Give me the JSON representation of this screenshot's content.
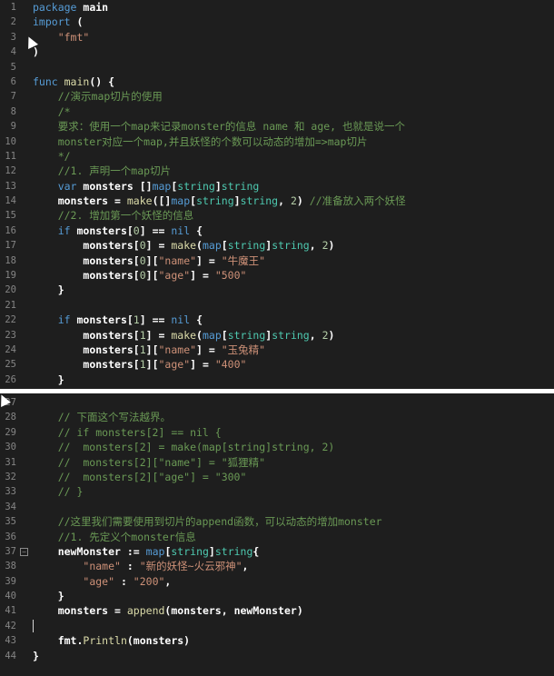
{
  "top_lines": [
    {
      "n": "1",
      "tokens": [
        {
          "t": "package ",
          "c": "kw"
        },
        {
          "t": "main",
          "c": "wt"
        }
      ]
    },
    {
      "n": "2",
      "tokens": [
        {
          "t": "import ",
          "c": "kw"
        },
        {
          "t": "(",
          "c": "wt"
        }
      ]
    },
    {
      "n": "3",
      "tokens": [
        {
          "t": "    ",
          "c": ""
        },
        {
          "t": "\"fmt\"",
          "c": "str"
        }
      ]
    },
    {
      "n": "4",
      "tokens": [
        {
          "t": ")",
          "c": "wt"
        }
      ]
    },
    {
      "n": "5",
      "tokens": []
    },
    {
      "n": "6",
      "tokens": [
        {
          "t": "func ",
          "c": "kw"
        },
        {
          "t": "main",
          "c": "fn"
        },
        {
          "t": "() {",
          "c": "wt"
        }
      ]
    },
    {
      "n": "7",
      "tokens": [
        {
          "t": "    //演示map切片的使用",
          "c": "cm"
        }
      ]
    },
    {
      "n": "8",
      "tokens": [
        {
          "t": "    /*",
          "c": "cm"
        }
      ]
    },
    {
      "n": "9",
      "tokens": [
        {
          "t": "    要求：使用一个map来记录monster的信息 name 和 age, 也就是说一个",
          "c": "cm"
        }
      ]
    },
    {
      "n": "10",
      "tokens": [
        {
          "t": "    monster对应一个map,并且妖怪的个数可以动态的增加=>map切片",
          "c": "cm"
        }
      ]
    },
    {
      "n": "11",
      "tokens": [
        {
          "t": "    */",
          "c": "cm"
        }
      ]
    },
    {
      "n": "12",
      "tokens": [
        {
          "t": "    //1. 声明一个map切片",
          "c": "cm"
        }
      ]
    },
    {
      "n": "13",
      "tokens": [
        {
          "t": "    ",
          "c": ""
        },
        {
          "t": "var ",
          "c": "kw"
        },
        {
          "t": "monsters ",
          "c": "wt"
        },
        {
          "t": "[]",
          "c": "wt"
        },
        {
          "t": "map",
          "c": "kw"
        },
        {
          "t": "[",
          "c": "wt"
        },
        {
          "t": "string",
          "c": "ty"
        },
        {
          "t": "]",
          "c": "wt"
        },
        {
          "t": "string",
          "c": "ty"
        }
      ]
    },
    {
      "n": "14",
      "tokens": [
        {
          "t": "    ",
          "c": ""
        },
        {
          "t": "monsters = ",
          "c": "wt"
        },
        {
          "t": "make",
          "c": "fn"
        },
        {
          "t": "([]",
          "c": "wt"
        },
        {
          "t": "map",
          "c": "kw"
        },
        {
          "t": "[",
          "c": "wt"
        },
        {
          "t": "string",
          "c": "ty"
        },
        {
          "t": "]",
          "c": "wt"
        },
        {
          "t": "string",
          "c": "ty"
        },
        {
          "t": ", ",
          "c": "wt"
        },
        {
          "t": "2",
          "c": "num"
        },
        {
          "t": ") ",
          "c": "wt"
        },
        {
          "t": "//准备放入两个妖怪",
          "c": "cm"
        }
      ]
    },
    {
      "n": "15",
      "tokens": [
        {
          "t": "    //2. 增加第一个妖怪的信息",
          "c": "cm"
        }
      ]
    },
    {
      "n": "16",
      "tokens": [
        {
          "t": "    ",
          "c": ""
        },
        {
          "t": "if ",
          "c": "kw"
        },
        {
          "t": "monsters[",
          "c": "wt"
        },
        {
          "t": "0",
          "c": "num"
        },
        {
          "t": "] == ",
          "c": "wt"
        },
        {
          "t": "nil",
          "c": "kw"
        },
        {
          "t": " {",
          "c": "wt"
        }
      ]
    },
    {
      "n": "17",
      "tokens": [
        {
          "t": "        ",
          "c": ""
        },
        {
          "t": "monsters[",
          "c": "wt"
        },
        {
          "t": "0",
          "c": "num"
        },
        {
          "t": "] = ",
          "c": "wt"
        },
        {
          "t": "make",
          "c": "fn"
        },
        {
          "t": "(",
          "c": "wt"
        },
        {
          "t": "map",
          "c": "kw"
        },
        {
          "t": "[",
          "c": "wt"
        },
        {
          "t": "string",
          "c": "ty"
        },
        {
          "t": "]",
          "c": "wt"
        },
        {
          "t": "string",
          "c": "ty"
        },
        {
          "t": ", ",
          "c": "wt"
        },
        {
          "t": "2",
          "c": "num"
        },
        {
          "t": ")",
          "c": "wt"
        }
      ]
    },
    {
      "n": "18",
      "tokens": [
        {
          "t": "        ",
          "c": ""
        },
        {
          "t": "monsters[",
          "c": "wt"
        },
        {
          "t": "0",
          "c": "num"
        },
        {
          "t": "][",
          "c": "wt"
        },
        {
          "t": "\"name\"",
          "c": "str"
        },
        {
          "t": "] = ",
          "c": "wt"
        },
        {
          "t": "\"牛魔王\"",
          "c": "str"
        }
      ]
    },
    {
      "n": "19",
      "tokens": [
        {
          "t": "        ",
          "c": ""
        },
        {
          "t": "monsters[",
          "c": "wt"
        },
        {
          "t": "0",
          "c": "num"
        },
        {
          "t": "][",
          "c": "wt"
        },
        {
          "t": "\"age\"",
          "c": "str"
        },
        {
          "t": "] = ",
          "c": "wt"
        },
        {
          "t": "\"500\"",
          "c": "str"
        }
      ]
    },
    {
      "n": "20",
      "tokens": [
        {
          "t": "    }",
          "c": "wt"
        }
      ]
    },
    {
      "n": "21",
      "tokens": []
    },
    {
      "n": "22",
      "tokens": [
        {
          "t": "    ",
          "c": ""
        },
        {
          "t": "if ",
          "c": "kw"
        },
        {
          "t": "monsters[",
          "c": "wt"
        },
        {
          "t": "1",
          "c": "num"
        },
        {
          "t": "] == ",
          "c": "wt"
        },
        {
          "t": "nil",
          "c": "kw"
        },
        {
          "t": " {",
          "c": "wt"
        }
      ]
    },
    {
      "n": "23",
      "tokens": [
        {
          "t": "        ",
          "c": ""
        },
        {
          "t": "monsters[",
          "c": "wt"
        },
        {
          "t": "1",
          "c": "num"
        },
        {
          "t": "] = ",
          "c": "wt"
        },
        {
          "t": "make",
          "c": "fn"
        },
        {
          "t": "(",
          "c": "wt"
        },
        {
          "t": "map",
          "c": "kw"
        },
        {
          "t": "[",
          "c": "wt"
        },
        {
          "t": "string",
          "c": "ty"
        },
        {
          "t": "]",
          "c": "wt"
        },
        {
          "t": "string",
          "c": "ty"
        },
        {
          "t": ", ",
          "c": "wt"
        },
        {
          "t": "2",
          "c": "num"
        },
        {
          "t": ")",
          "c": "wt"
        }
      ]
    },
    {
      "n": "24",
      "tokens": [
        {
          "t": "        ",
          "c": ""
        },
        {
          "t": "monsters[",
          "c": "wt"
        },
        {
          "t": "1",
          "c": "num"
        },
        {
          "t": "][",
          "c": "wt"
        },
        {
          "t": "\"name\"",
          "c": "str"
        },
        {
          "t": "] = ",
          "c": "wt"
        },
        {
          "t": "\"玉兔精\"",
          "c": "str"
        }
      ]
    },
    {
      "n": "25",
      "tokens": [
        {
          "t": "        ",
          "c": ""
        },
        {
          "t": "monsters[",
          "c": "wt"
        },
        {
          "t": "1",
          "c": "num"
        },
        {
          "t": "][",
          "c": "wt"
        },
        {
          "t": "\"age\"",
          "c": "str"
        },
        {
          "t": "] = ",
          "c": "wt"
        },
        {
          "t": "\"400\"",
          "c": "str"
        }
      ]
    },
    {
      "n": "26",
      "tokens": [
        {
          "t": "    }",
          "c": "wt"
        }
      ]
    }
  ],
  "bottom_lines": [
    {
      "n": "27",
      "tokens": []
    },
    {
      "n": "28",
      "tokens": [
        {
          "t": "    // 下面这个写法越界。",
          "c": "cm"
        }
      ]
    },
    {
      "n": "29",
      "tokens": [
        {
          "t": "    // if monsters[2] == nil {",
          "c": "cm"
        }
      ]
    },
    {
      "n": "30",
      "tokens": [
        {
          "t": "    //  monsters[2] = make(map[string]string, 2)",
          "c": "cm"
        }
      ]
    },
    {
      "n": "31",
      "tokens": [
        {
          "t": "    //  monsters[2][\"name\"] = \"狐狸精\"",
          "c": "cm"
        }
      ]
    },
    {
      "n": "32",
      "tokens": [
        {
          "t": "    //  monsters[2][\"age\"] = \"300\"",
          "c": "cm"
        }
      ]
    },
    {
      "n": "33",
      "tokens": [
        {
          "t": "    // }",
          "c": "cm"
        }
      ]
    },
    {
      "n": "34",
      "tokens": []
    },
    {
      "n": "35",
      "tokens": [
        {
          "t": "    //这里我们需要使用到切片的append函数，可以动态的增加monster",
          "c": "cm"
        }
      ]
    },
    {
      "n": "36",
      "tokens": [
        {
          "t": "    //1. 先定义个monster信息",
          "c": "cm"
        }
      ]
    },
    {
      "n": "37",
      "fold": true,
      "tokens": [
        {
          "t": "    ",
          "c": ""
        },
        {
          "t": "newMonster ",
          "c": "wt"
        },
        {
          "t": ":= ",
          "c": "wt"
        },
        {
          "t": "map",
          "c": "kw"
        },
        {
          "t": "[",
          "c": "wt"
        },
        {
          "t": "string",
          "c": "ty"
        },
        {
          "t": "]",
          "c": "wt"
        },
        {
          "t": "string",
          "c": "ty"
        },
        {
          "t": "{",
          "c": "wt"
        }
      ]
    },
    {
      "n": "38",
      "tokens": [
        {
          "t": "        ",
          "c": ""
        },
        {
          "t": "\"name\"",
          "c": "str"
        },
        {
          "t": " : ",
          "c": "wt"
        },
        {
          "t": "\"新的妖怪~火云邪神\"",
          "c": "str"
        },
        {
          "t": ",",
          "c": "wt"
        }
      ]
    },
    {
      "n": "39",
      "tokens": [
        {
          "t": "        ",
          "c": ""
        },
        {
          "t": "\"age\"",
          "c": "str"
        },
        {
          "t": " : ",
          "c": "wt"
        },
        {
          "t": "\"200\"",
          "c": "str"
        },
        {
          "t": ",",
          "c": "wt"
        }
      ]
    },
    {
      "n": "40",
      "tokens": [
        {
          "t": "    }",
          "c": "wt"
        }
      ]
    },
    {
      "n": "41",
      "tokens": [
        {
          "t": "    ",
          "c": ""
        },
        {
          "t": "monsters = ",
          "c": "wt"
        },
        {
          "t": "append",
          "c": "fn"
        },
        {
          "t": "(monsters, newMonster)",
          "c": "wt"
        }
      ]
    },
    {
      "n": "42",
      "caret": true,
      "tokens": []
    },
    {
      "n": "43",
      "tokens": [
        {
          "t": "    ",
          "c": ""
        },
        {
          "t": "fmt.",
          "c": "wt"
        },
        {
          "t": "Println",
          "c": "fn"
        },
        {
          "t": "(monsters)",
          "c": "wt"
        }
      ]
    },
    {
      "n": "44",
      "tokens": [
        {
          "t": "}",
          "c": "wt"
        }
      ]
    }
  ]
}
